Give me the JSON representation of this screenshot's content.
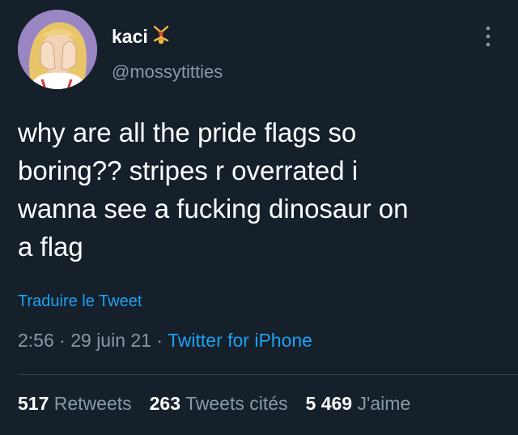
{
  "author": {
    "display_name": "kaci",
    "badge_icon": "cartwheel-person-emoji",
    "handle": "@mossytitties",
    "avatar_icon": "cartoon-avatar-facepalm"
  },
  "more_icon": "vertical-ellipsis-icon",
  "tweet": {
    "lines": [
      "why are all the pride flags so",
      "boring?? stripes r overrated i",
      "wanna see a fucking dinosaur on",
      "a flag"
    ]
  },
  "translate_link": "Traduire le Tweet",
  "meta": {
    "time": "2:56",
    "separator": " · ",
    "date": "29 juin 21",
    "source": "Twitter for iPhone"
  },
  "stats": {
    "retweets_count": "517",
    "retweets_label": "Retweets",
    "quotes_count": "263",
    "quotes_label": "Tweets cités",
    "likes_count": "5 469",
    "likes_label": "J'aime"
  },
  "colors": {
    "background": "#15202b",
    "link": "#1da1f2",
    "secondary_text": "#8899a6",
    "divider": "#38444d"
  }
}
